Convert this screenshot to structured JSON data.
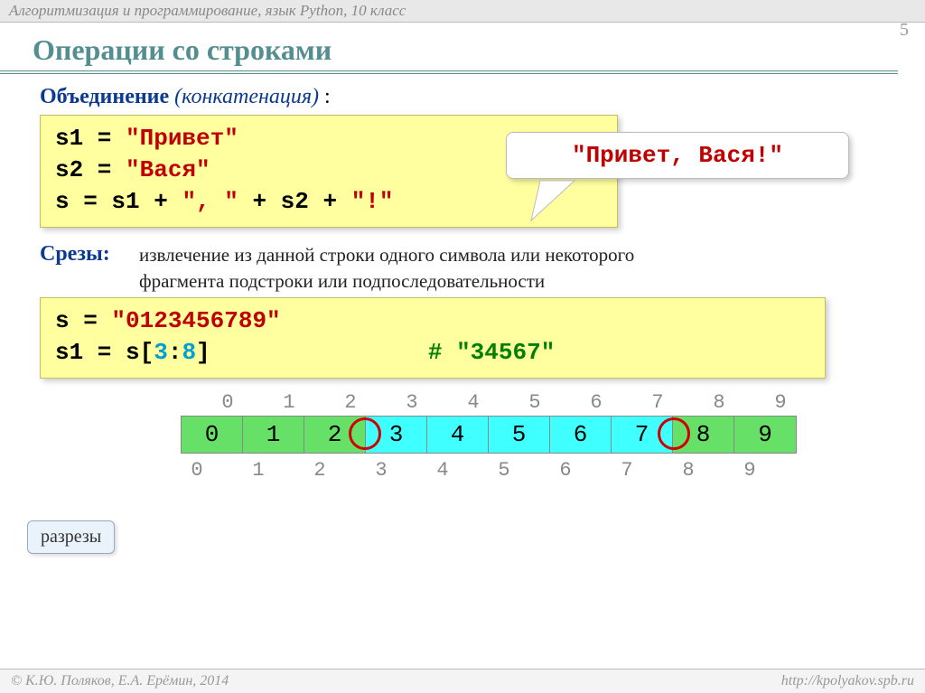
{
  "header": "Алгоритмизация и программирование, язык Python, 10 класс",
  "page_number": "5",
  "title": "Операции со строками",
  "section1": {
    "bold": "Объединение",
    "italic": "(конкатенация)",
    "colon": " :"
  },
  "code1": {
    "l1a": "s1 = ",
    "l1b": "\"Привет\"",
    "l2a": "s2 = ",
    "l2b": "\"Вася\"",
    "l3a": "s  = s1 + ",
    "l3b": "\", \"",
    "l3c": " + s2 + ",
    "l3d": "\"!\""
  },
  "callout": "\"Привет, Вася!\"",
  "section2": {
    "label": "Срезы:",
    "desc": "извлечение из данной строки одного символа или некоторого фрагмента подстроки или подпоследовательности"
  },
  "code2": {
    "l1a": "s = ",
    "l1b": "\"0123456789\"",
    "l2a": "s1 = s[",
    "l2b": "3",
    "l2c": ":",
    "l2d": "8",
    "l2e": "]",
    "l2comment": "# \"34567\""
  },
  "idx_top": [
    "0",
    "1",
    "2",
    "3",
    "4",
    "5",
    "6",
    "7",
    "8",
    "9"
  ],
  "cells": [
    "0",
    "1",
    "2",
    "3",
    "4",
    "5",
    "6",
    "7",
    "8",
    "9"
  ],
  "idx_bot": [
    "0",
    "1",
    "2",
    "3",
    "4",
    "5",
    "6",
    "7",
    "8",
    "9"
  ],
  "cuts_label": "разрезы",
  "footer": {
    "left": "© К.Ю. Поляков, Е.А. Ерёмин, 2014",
    "right": "http://kpolyakov.spb.ru"
  }
}
